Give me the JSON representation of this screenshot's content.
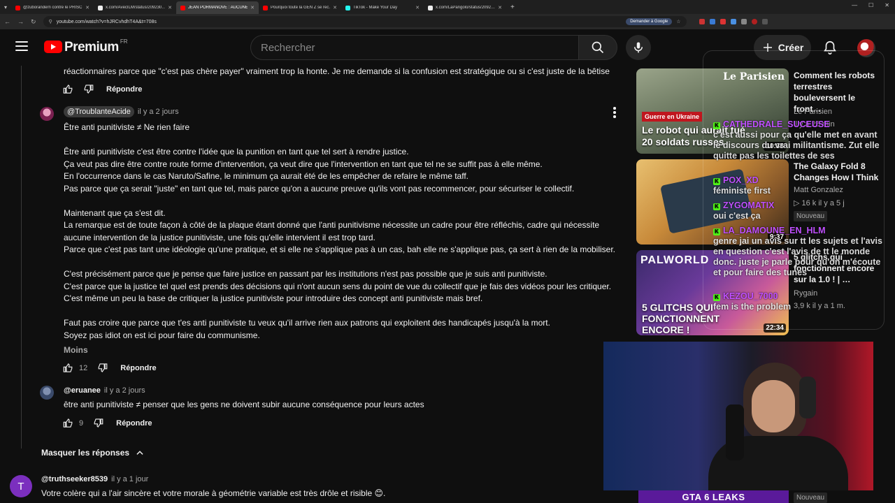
{
  "browser": {
    "tabs": [
      {
        "title": "@zuborandern contre le PRISC…",
        "fav": "#ff0000"
      },
      {
        "title": "x.com/AvecILM/status/209230…",
        "fav": "#eeeeee"
      },
      {
        "title": "JEAN PORMANOVE : AUCUNE…",
        "fav": "#ff0000"
      },
      {
        "title": "Pourquoi toute la GEN Z se rec…",
        "fav": "#ff0000"
      },
      {
        "title": "TikTok - Make Your Day",
        "fav": "#25f4ee"
      },
      {
        "title": "x.com/LaPangolo/status/2092…",
        "fav": "#eeeeee"
      }
    ],
    "url": "youtube.com/watch?v=hJRCvhdhT4A&t=708s",
    "gemini_label": "Demander à Google"
  },
  "header": {
    "logo_text": "Premium",
    "country": "FR",
    "search_placeholder": "Rechercher",
    "create_label": "Créer"
  },
  "comments": {
    "prev_tail": "réactionnaires parce que \"c'est pas chère payer\" vraiment trop la honte. Je me demande si la confusion est stratégique ou si c'est juste de la bêtise",
    "reply_label": "Répondre",
    "c1": {
      "author": "@TroublanteAcide",
      "time": "il y a 2 jours",
      "lines": [
        "Être anti punitiviste ≠ Ne rien faire",
        "",
        "Être anti punitiviste c'est être contre l'idée que la punition en tant que tel sert à rendre justice.",
        "Ça veut pas dire être contre route forme d'intervention, ça veut dire que l'intervention en tant que tel ne se suffit pas à elle même.",
        "En l'occurrence dans le cas Naruto/Safine, le minimum ça aurait été de les empêcher de refaire le même taff.",
        "Pas parce que ça serait \"juste\" en tant que tel, mais parce qu'on a aucune preuve qu'ils vont pas recommencer, pour sécuriser le collectif.",
        "",
        "Maintenant que ça s'est dit.",
        "La remarque est de toute façon à côté de la plaque étant donné que l'anti punitivisme nécessite un cadre pour être réfléchis, cadre qui nécessite",
        "aucune intervention de la justice punitiviste, une fois qu'elle intervient il est trop tard.",
        "Parce que c'est pas tant une idéologie qu'une pratique, et si elle ne s'applique pas à un cas, bah elle ne s'applique pas, ça sert à rien de la mobiliser.",
        "",
        "C'est précisément parce que je pense que faire justice en passant par les institutions n'est pas possible que je suis anti punitiviste.",
        "C'est parce que la justice tel quel est prends des décisions qui n'ont aucun sens du point de vue du collectif que je fais des vidéos pour les critiquer.",
        "C'est même un peu la base de critiquer la justice punitiviste pour introduire des concept anti punitiviste mais bref.",
        "",
        "Faut pas croire que parce que t'es anti punitiviste tu veux qu'il arrive rien aux patrons qui exploitent des handicapés jusqu'à la mort.",
        "Soyez pas idiot on est ici pour faire du communisme."
      ],
      "less_label": "Moins",
      "likes": "12"
    },
    "c2": {
      "author": "@eruanee",
      "time": "il y a 2 jours",
      "text": "être anti punitiviste ≠ penser que les gens ne doivent subir aucune conséquence pour leurs actes",
      "likes": "9"
    },
    "hide_replies_label": "Masquer les réponses",
    "c3": {
      "avatar_letter": "T",
      "author": "@truthseeker8539",
      "time": "il y a 1 jour",
      "text": "Votre colère qui a l'air sincère et votre morale à géométrie variable est très drôle et risible 😊."
    }
  },
  "sidebar": {
    "items": [
      {
        "title": "Comment les robots terrestres bouleversent le front…",
        "channel": "Le Parisien",
        "stats": "il y a 25 min",
        "duration": "10:33",
        "thumb_label_top": "Guerre en Ukraine",
        "thumb_label": "Le robot qui aurait tué 20 soldats russes",
        "brand": "Le Parisien"
      },
      {
        "title": "The Galaxy Fold 8 Changes How I Think",
        "channel": "Matt Gonzalez",
        "stats": "16 k   il y a 5 j",
        "badge": "Nouveau",
        "duration": "9:37"
      },
      {
        "title": "5 glitchs qui fonctionnent encore sur la 1.0 ! | …",
        "channel": "Rygain",
        "stats": "3,9 k   il y a 1 m.",
        "duration": "22:34",
        "thumb_label_top": "PALWORLD",
        "thumb_label": "5 GLITCHS QUI FONCTIONNENT ENCORE !"
      }
    ]
  },
  "stream_chat": [
    {
      "name": "CATHEDRALE_SUCEUSE",
      "text": "c'est aussi pour ça qu'elle met en avant le discours du vrai militantisme. Zut elle quitte pas les toilettes de ses"
    },
    {
      "name": "POX_XD",
      "text": "féministe first"
    },
    {
      "name": "ZYGOMATIX",
      "text": "oui c'est ça"
    },
    {
      "name": "LA_DAMOUNE_EN_HLM",
      "text": "genre jai un avis sur tt les sujets et l'avis en question c'est l'avis de tt le monde donc. juste je parle pour qu'on m'écoute et pour faire des tunes"
    },
    {
      "name": "KEZOU_7000",
      "text": "fem is the problem"
    }
  ],
  "overlay": {
    "banner": "GTA 6 LEAKS",
    "badge": "Nouveau"
  },
  "colors": {
    "accent": "#ff0000",
    "bg": "#0f0f0f",
    "chip": "#3a3a3a",
    "chat_name": "#c050ff",
    "kick": "#53fc18"
  }
}
